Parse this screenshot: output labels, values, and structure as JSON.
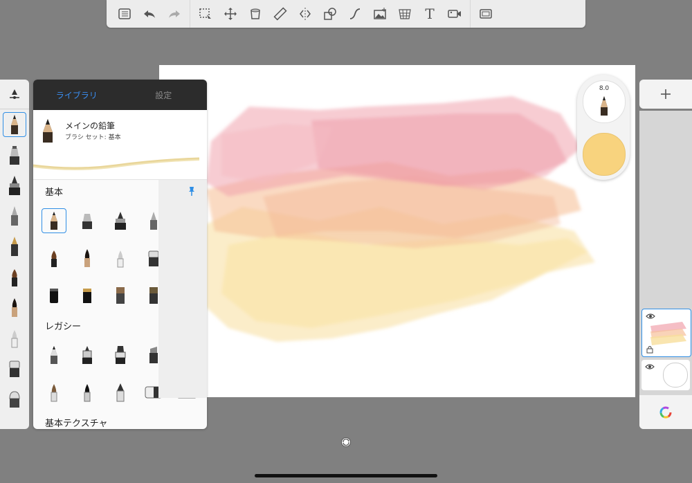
{
  "toolbar": {
    "items": [
      "list-icon",
      "undo-icon",
      "redo-icon",
      "selection-icon",
      "move-icon",
      "fill-icon",
      "ruler-icon",
      "symmetry-icon",
      "shape-icon",
      "curve-icon",
      "image-add-icon",
      "perspective-icon",
      "text-icon",
      "video-icon",
      "fullscreen-icon"
    ]
  },
  "library": {
    "tab_library": "ライブラリ",
    "tab_settings": "設定",
    "current_brush": {
      "name": "メインの鉛筆",
      "set": "ブラシ セット: 基本"
    },
    "sections": [
      {
        "title": "基本"
      },
      {
        "title": "レガシー"
      },
      {
        "title": "基本テクスチャ"
      }
    ]
  },
  "brush_widget": {
    "size": "8.0",
    "color": "#f8d37e"
  },
  "colors": {
    "accent": "#2f8ee5",
    "canvas_bg": "#ffffff",
    "app_bg": "#808080",
    "stroke_pink": "#f1a3ad",
    "stroke_peach": "#f6c19a",
    "stroke_yellow": "#f8df9c"
  }
}
